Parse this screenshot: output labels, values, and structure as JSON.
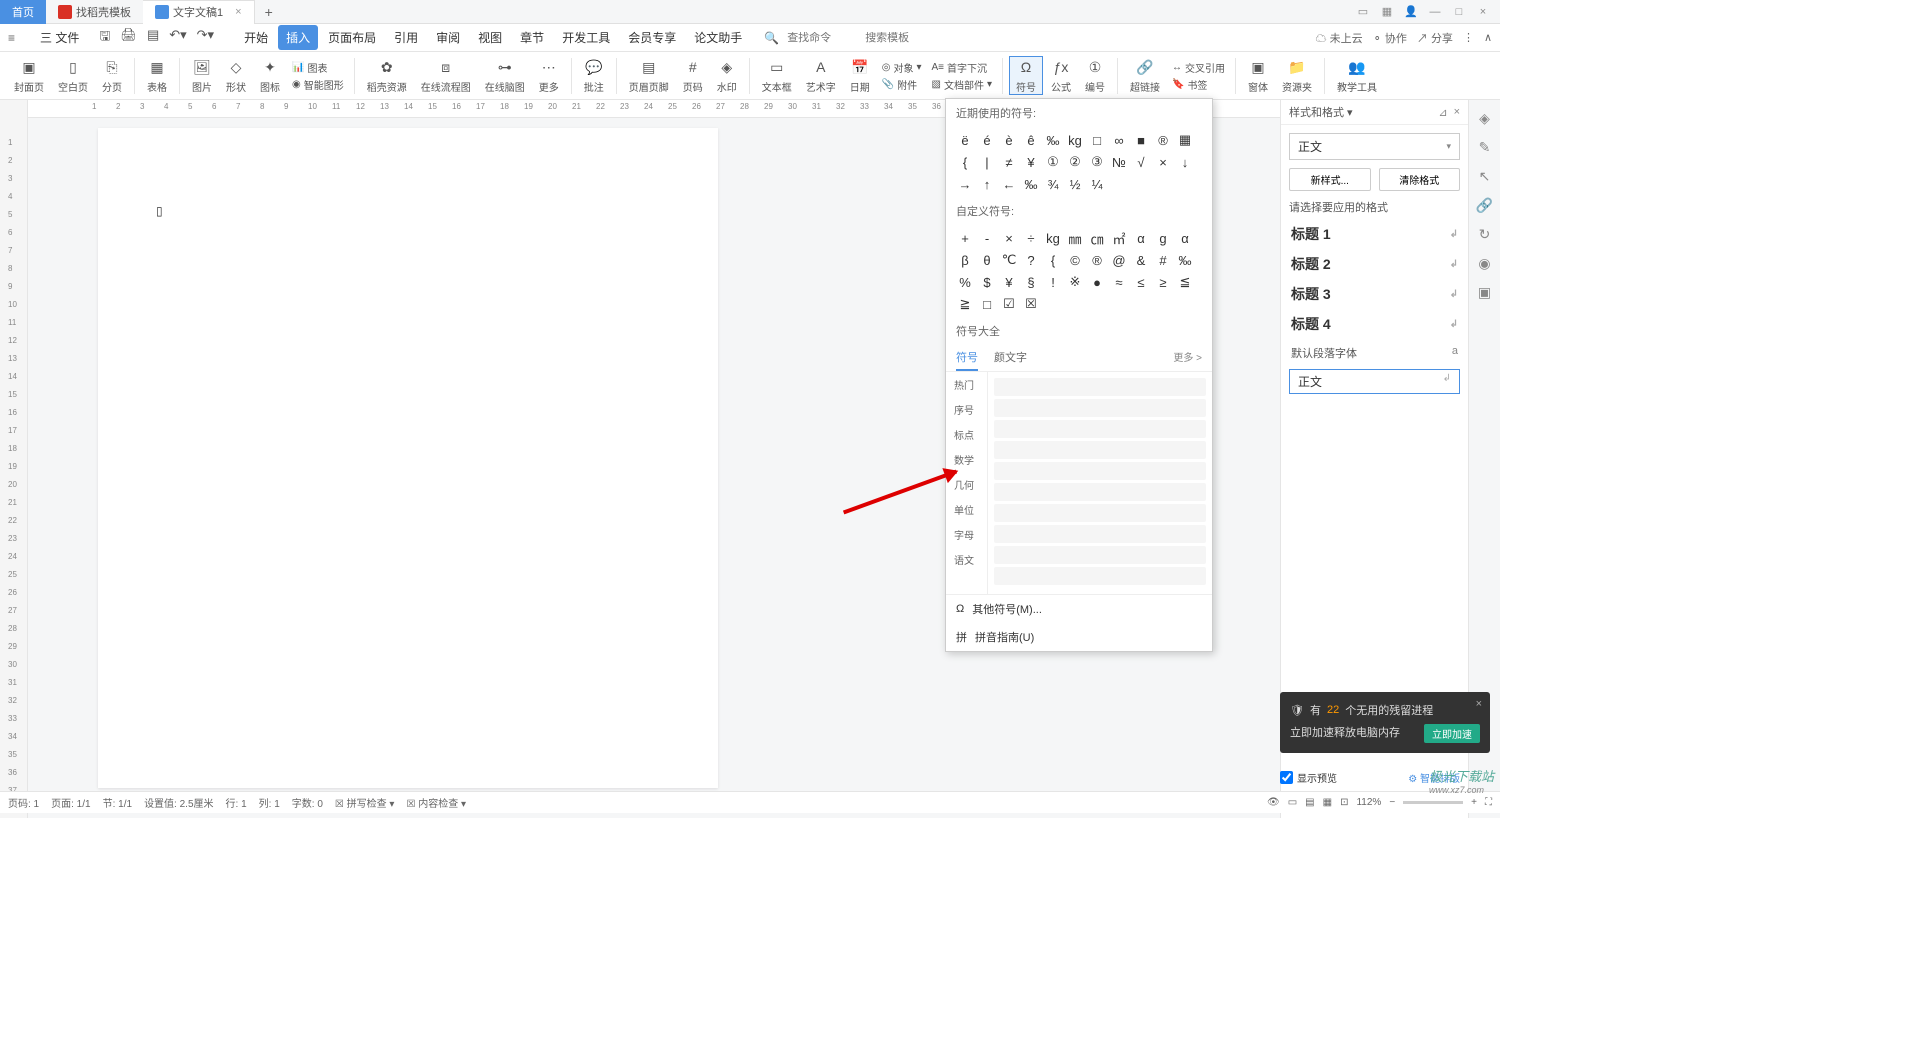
{
  "tabs": {
    "home": "首页",
    "templates": "找稻壳模板",
    "doc": "文字文稿1"
  },
  "file_menu": "三 文件",
  "menu": {
    "start": "开始",
    "insert": "插入",
    "page_layout": "页面布局",
    "references": "引用",
    "review": "审阅",
    "view": "视图",
    "chapter": "章节",
    "dev": "开发工具",
    "member": "会员专享",
    "thesis": "论文助手"
  },
  "search": {
    "cmd": "查找命令",
    "tpl": "搜索模板"
  },
  "topright": {
    "cloud": "未上云",
    "collab": "协作",
    "share": "分享"
  },
  "ribbon": {
    "cover": "封面页",
    "blank": "空白页",
    "pagebreak": "分页",
    "table": "表格",
    "picture": "图片",
    "shape": "形状",
    "icon": "图标",
    "chart": "图表",
    "smartart": "智能图形",
    "docres": "稻壳资源",
    "flowchart": "在线流程图",
    "mindmap": "在线脑图",
    "more": "更多",
    "approve": "批注",
    "header": "页眉页脚",
    "pagenum": "页码",
    "watermark": "水印",
    "textbox": "文本框",
    "wordart": "艺术字",
    "date": "日期",
    "attachment": "附件",
    "object": "对象",
    "dropcap": "首字下沉",
    "docparts": "文档部件",
    "symbol": "符号",
    "formula": "公式",
    "number": "编号",
    "hyperlink": "超链接",
    "crossref": "交叉引用",
    "bookmark": "书签",
    "window": "窗体",
    "resource": "资源夹",
    "teach": "教学工具"
  },
  "symbol_panel": {
    "recent": "近期使用的符号:",
    "recent_syms": [
      "ë",
      "é",
      "è",
      "ê",
      "‰",
      "kg",
      "□",
      "∞",
      "■",
      "®",
      "▦",
      "{",
      "|",
      "≠",
      "¥",
      "①",
      "②",
      "③",
      "№",
      "√",
      "×",
      "↓",
      "→",
      "↑",
      "←",
      "‰",
      "¾",
      "½",
      "¼"
    ],
    "custom": "自定义符号:",
    "custom_syms": [
      "+",
      "-",
      "×",
      "÷",
      "kg",
      "㎜",
      "㎝",
      "㎡",
      "α",
      "g",
      "α",
      "β",
      "θ",
      "℃",
      "?",
      "{",
      "©",
      "®",
      "@",
      "&",
      "#",
      "‰",
      "%",
      "$",
      "¥",
      "§",
      "!",
      "※",
      "●",
      "≈",
      "≤",
      "≥",
      "≦",
      "≧",
      "□",
      "☑",
      "☒"
    ],
    "all": "符号大全",
    "tab_sym": "符号",
    "tab_face": "颜文字",
    "more": "更多 >",
    "cats": [
      "热门",
      "序号",
      "标点",
      "数学",
      "几何",
      "单位",
      "字母",
      "语文"
    ],
    "other": "其他符号(M)...",
    "pinyin": "拼音指南(U)"
  },
  "styles": {
    "title": "样式和格式 ▾",
    "current": "正文",
    "new_btn": "新样式...",
    "clear_btn": "清除格式",
    "apply": "请选择要应用的格式",
    "h1": "标题 1",
    "h2": "标题 2",
    "h3": "标题 3",
    "h4": "标题 4",
    "default_para": "默认段落字体",
    "selected": "正文",
    "show_preview": "显示预览",
    "smart": "智能排版"
  },
  "notif": {
    "text_pre": "有 ",
    "num": "22",
    "text_post": " 个无用的残留进程",
    "sub": "立即加速释放电脑内存",
    "btn": "立即加速"
  },
  "watermark": {
    "main": "极光下载站",
    "sub": "www.xz7.com"
  },
  "status": {
    "page": "页码: 1",
    "pages": "页面: 1/1",
    "section": "节: 1/1",
    "pos": "设置值: 2.5厘米",
    "line": "行: 1",
    "col": "列: 1",
    "chars": "字数: 0",
    "spell": "拼写检查",
    "content": "内容检查",
    "zoom": "112%"
  }
}
